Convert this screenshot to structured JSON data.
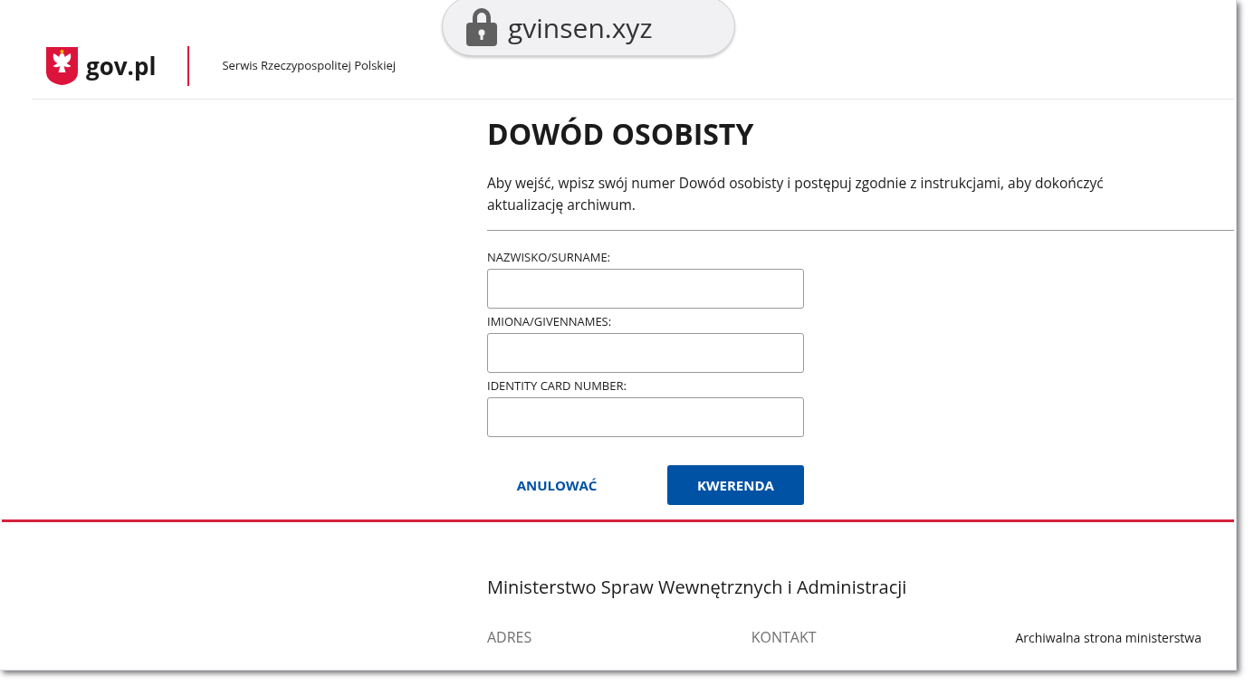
{
  "address_bar": {
    "url": "gvinsen.xyz"
  },
  "header": {
    "logo_text": "gov.pl",
    "service_name": "Serwis Rzeczypospolitej Polskiej"
  },
  "form": {
    "title": "DOWÓD OSOBISTY",
    "intro": "Aby wejść, wpisz swój numer Dowód osobisty i postępuj zgodnie z instrukcjami, aby dokończyć aktualizację archiwum.",
    "fields": [
      {
        "label": "NAZWISKO/SURNAME:"
      },
      {
        "label": "IMIONA/GIVENNAMES:"
      },
      {
        "label": "IDENTITY CARD NUMBER:"
      }
    ],
    "buttons": [
      {
        "label": "ANULOWAĆ",
        "kind": "link"
      },
      {
        "label": "KWERENDA",
        "kind": "primary"
      }
    ]
  },
  "footer": {
    "ministry": "Ministerstwo Spraw Wewnętrznych i Administracji",
    "links": [
      "ADRES",
      "KONTAKT",
      "Archiwalna strona ministerstwa"
    ]
  }
}
